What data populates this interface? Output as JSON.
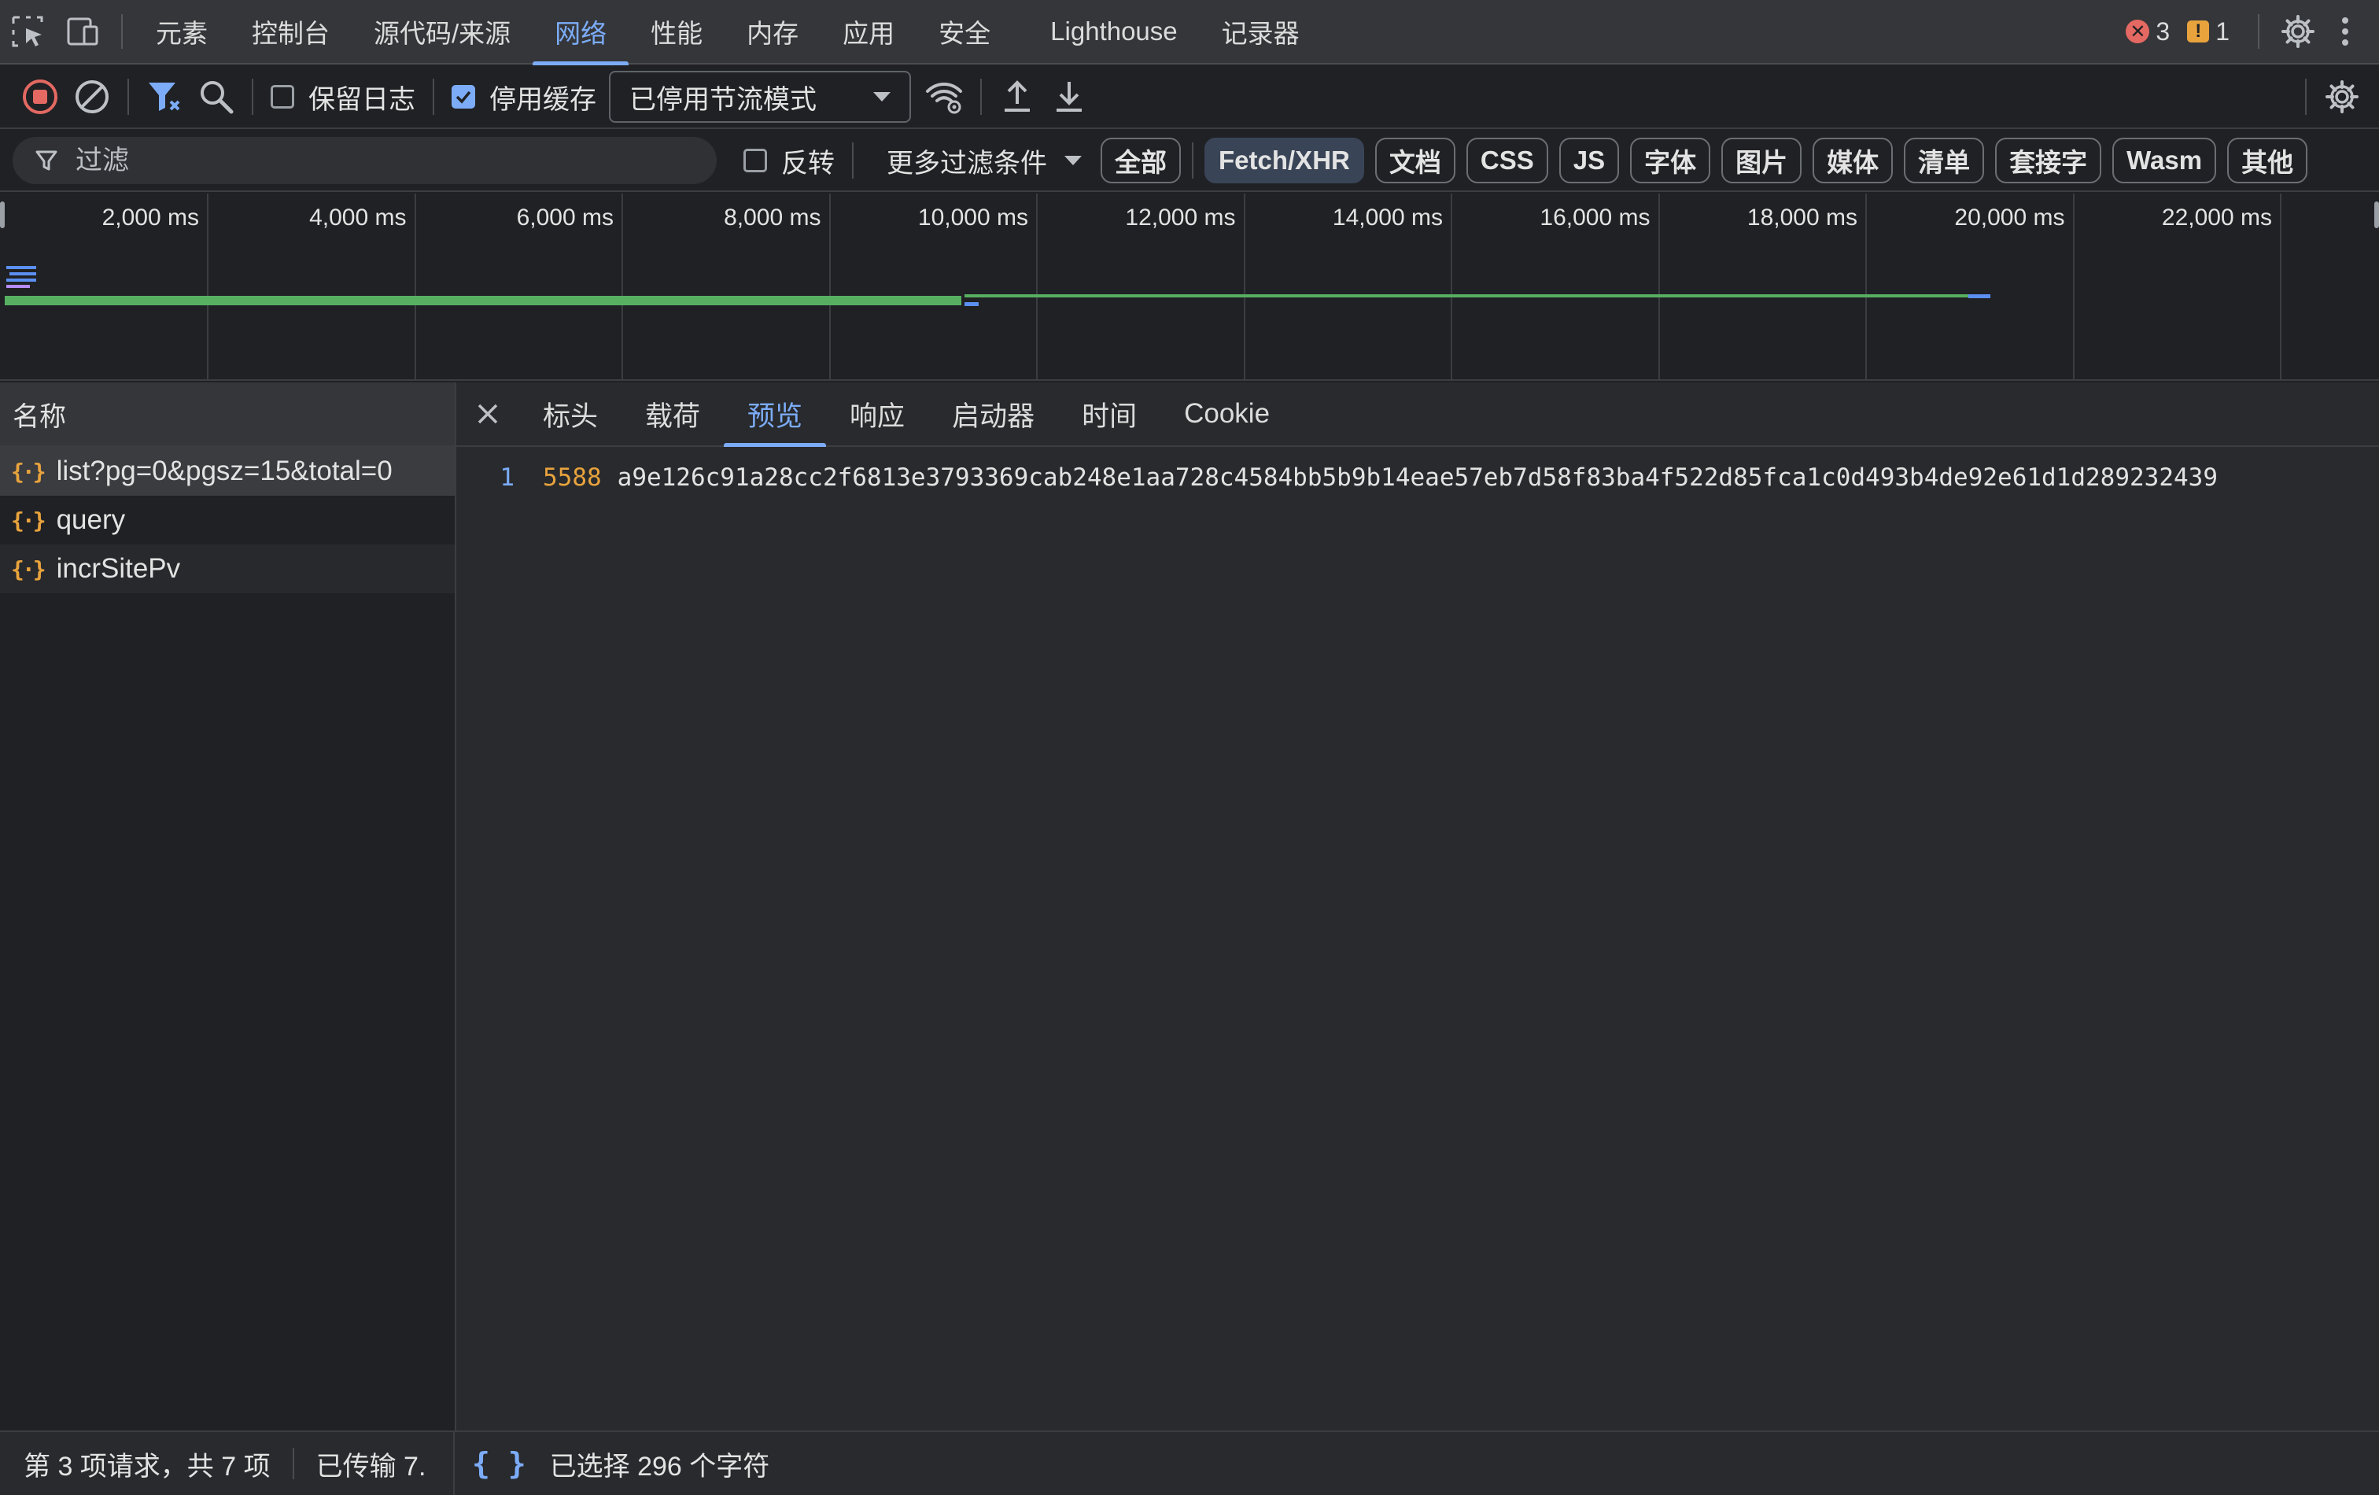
{
  "main_tabs": [
    "元素",
    "控制台",
    "源代码/来源",
    "网络",
    "性能",
    "内存",
    "应用",
    "安全",
    "Lighthouse",
    "记录器"
  ],
  "active_tab": "网络",
  "issues": {
    "errors": "3",
    "warnings": "1"
  },
  "toolbar": {
    "preserve_log": {
      "label": "保留日志",
      "checked": false
    },
    "disable_cache": {
      "label": "停用缓存",
      "checked": true
    },
    "throttling": "已停用节流模式"
  },
  "filter": {
    "placeholder": "过滤",
    "invert_label": "反转",
    "more_filters": "更多过滤条件",
    "types": [
      "全部",
      "Fetch/XHR",
      "文档",
      "CSS",
      "JS",
      "字体",
      "图片",
      "媒体",
      "清单",
      "套接字",
      "Wasm",
      "其他"
    ],
    "active_type": "Fetch/XHR"
  },
  "timeline": {
    "ticks": [
      "2,000 ms",
      "4,000 ms",
      "6,000 ms",
      "8,000 ms",
      "10,000 ms",
      "12,000 ms",
      "14,000 ms",
      "16,000 ms",
      "18,000 ms",
      "20,000 ms",
      "22,000 ms"
    ],
    "colors": {
      "waiting": "#57b061",
      "download": "#5c8ff2",
      "queue": "#b58cf7"
    }
  },
  "requests": {
    "header": "名称",
    "items": [
      "list?pg=0&pgsz=15&total=0",
      "query",
      "incrSitePv"
    ],
    "selected_index": 0
  },
  "detail_tabs": [
    "标头",
    "载荷",
    "预览",
    "响应",
    "启动器",
    "时间",
    "Cookie"
  ],
  "active_detail_tab": "预览",
  "preview": {
    "line_number": "1",
    "number": "5588",
    "text": "a9e126c91a28cc2f6813e3793369cab248e1aa728c4584bb5b9b14eae57eb7d58f83ba4f522d85fca1c0d493b4de92e61d1d289232439"
  },
  "status": {
    "requests": "第 3 项请求，共 7 项",
    "transferred": "已传输 7.",
    "selection": "已选择 296 个字符"
  }
}
